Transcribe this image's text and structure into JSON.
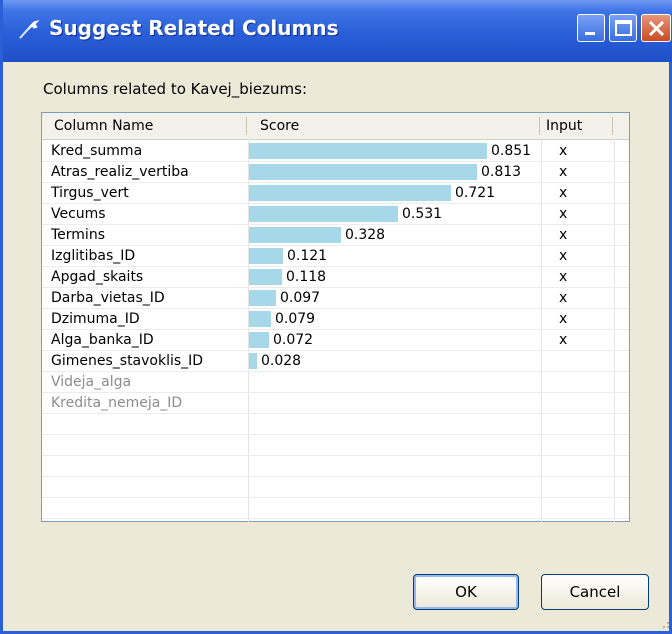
{
  "window": {
    "title": "Suggest Related Columns",
    "icon": "tool-icon",
    "controls": [
      "minimize",
      "maximize",
      "close"
    ]
  },
  "label": "Columns related to Kavej_biezums:",
  "columns": {
    "name": "Column Name",
    "score": "Score",
    "input": "Input"
  },
  "rows": [
    {
      "name": "Kred_summa",
      "score": "0.851",
      "value": 0.851,
      "input": "x",
      "enabled": true
    },
    {
      "name": "Atras_realiz_vertiba",
      "score": "0.813",
      "value": 0.813,
      "input": "x",
      "enabled": true
    },
    {
      "name": "Tirgus_vert",
      "score": "0.721",
      "value": 0.721,
      "input": "x",
      "enabled": true
    },
    {
      "name": "Vecums",
      "score": "0.531",
      "value": 0.531,
      "input": "x",
      "enabled": true
    },
    {
      "name": "Termins",
      "score": "0.328",
      "value": 0.328,
      "input": "x",
      "enabled": true
    },
    {
      "name": "Izglitibas_ID",
      "score": "0.121",
      "value": 0.121,
      "input": "x",
      "enabled": true
    },
    {
      "name": "Apgad_skaits",
      "score": "0.118",
      "value": 0.118,
      "input": "x",
      "enabled": true
    },
    {
      "name": "Darba_vietas_ID",
      "score": "0.097",
      "value": 0.097,
      "input": "x",
      "enabled": true
    },
    {
      "name": "Dzimuma_ID",
      "score": "0.079",
      "value": 0.079,
      "input": "x",
      "enabled": true
    },
    {
      "name": "Alga_banka_ID",
      "score": "0.072",
      "value": 0.072,
      "input": "x",
      "enabled": true
    },
    {
      "name": "Gimenes_stavoklis_ID",
      "score": "0.028",
      "value": 0.028,
      "input": "",
      "enabled": true
    },
    {
      "name": "Videja_alga",
      "score": "",
      "value": null,
      "input": "",
      "enabled": false
    },
    {
      "name": "Kredita_nemeja_ID",
      "score": "",
      "value": null,
      "input": "",
      "enabled": false
    }
  ],
  "buttons": {
    "ok": "OK",
    "cancel": "Cancel"
  },
  "colors": {
    "bar": "#a6d8e9",
    "title_bar": "#2a5ed8",
    "disabled_text": "#8c8c8c"
  }
}
